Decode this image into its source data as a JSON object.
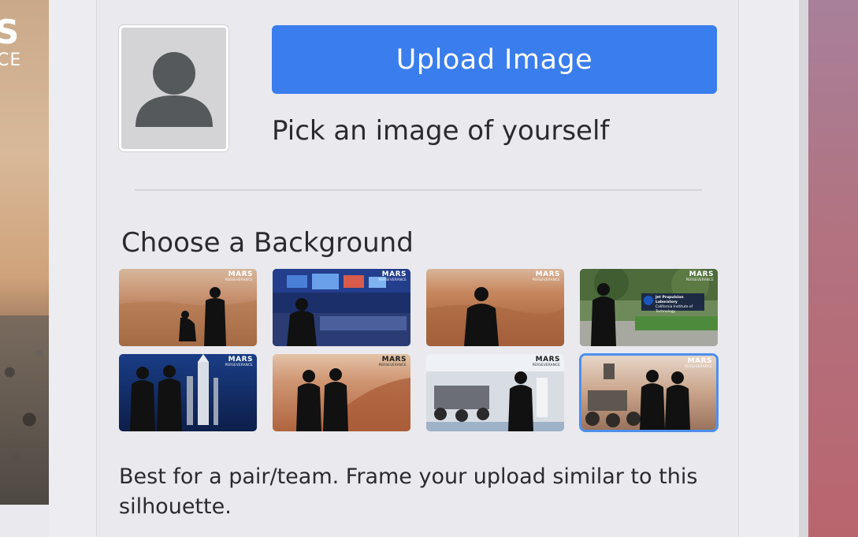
{
  "left_backdrop": {
    "logo_text": "S",
    "logo_sub": "CE"
  },
  "profile": {
    "upload_button_label": "Upload Image",
    "pick_hint": "Pick an image of yourself"
  },
  "backgrounds": {
    "heading": "Choose a Background",
    "badge_title": "MARS",
    "badge_subtitle": "PERSEVERANCE",
    "jpl_sign_line1": "Jet Propulsion Laboratory",
    "jpl_sign_line2": "California Institute of Technology",
    "items": [
      {
        "scene": "mars-desert-with-dog",
        "selected": false
      },
      {
        "scene": "mission-control-room",
        "selected": false
      },
      {
        "scene": "mars-terrain",
        "selected": false
      },
      {
        "scene": "jpl-campus-sign",
        "selected": false
      },
      {
        "scene": "rocket-launch-pad-pair",
        "selected": false
      },
      {
        "scene": "mars-dunes-pair",
        "selected": false
      },
      {
        "scene": "rover-clean-room",
        "selected": false
      },
      {
        "scene": "perseverance-rover-pair",
        "selected": true
      }
    ],
    "selected_description": "Best for a pair/team. Frame your upload similar to this silhouette."
  },
  "colors": {
    "accent": "#3a7ded",
    "selected_outline": "#4d8fee",
    "text": "#2b2b2e",
    "panel_bg": "#e9e9ee"
  }
}
